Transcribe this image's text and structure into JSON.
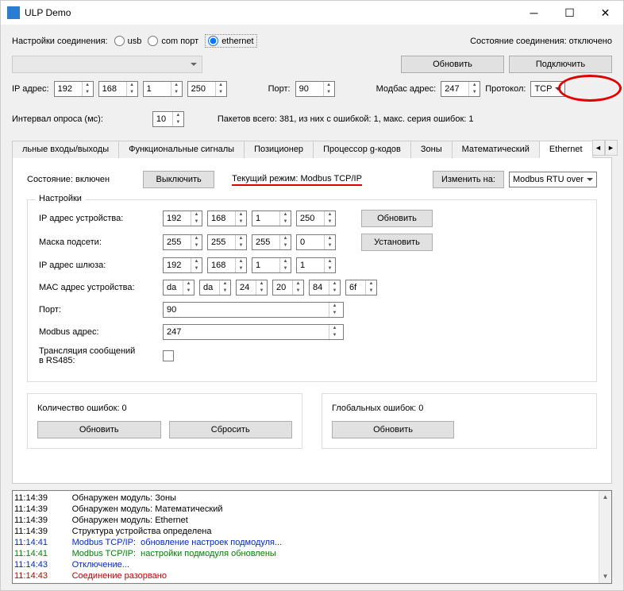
{
  "title": "ULP Demo",
  "conn": {
    "settings_label": "Настройки соединения:",
    "radio_usb": "usb",
    "radio_com": "com порт",
    "radio_eth": "ethernet",
    "status_label": "Состояние соединения: отключено",
    "refresh": "Обновить",
    "connect": "Подключить",
    "ip_label": "IP адрес:",
    "ip": [
      "192",
      "168",
      "1",
      "250"
    ],
    "port_label": "Порт:",
    "port": "90",
    "modbus_addr_label": "Модбас адрес:",
    "modbus_addr": "247",
    "protocol_label": "Протокол:",
    "protocol": "TCP",
    "interval_label": "Интервал опроса (мс):",
    "interval": "10",
    "packets": "Пакетов всего: 381, из них с ошибкой: 1, макс. серия ошибок: 1"
  },
  "tabs": {
    "t1": "льные входы/выходы",
    "t2": "Функциональные сигналы",
    "t3": "Позиционер",
    "t4": "Процессор g-кодов",
    "t5": "Зоны",
    "t6": "Математический",
    "t7": "Ethernet"
  },
  "eth": {
    "state_label": "Состояние: включен",
    "off_btn": "Выключить",
    "mode_text": "Текущий режим: Modbus TCP/IP",
    "change_to": "Изменить на:",
    "change_val": "Modbus RTU over",
    "settings_title": "Настройки",
    "ip_dev_label": "IP адрес устройства:",
    "ip_dev": [
      "192",
      "168",
      "1",
      "250"
    ],
    "refresh": "Обновить",
    "mask_label": "Маска подсети:",
    "mask": [
      "255",
      "255",
      "255",
      "0"
    ],
    "set": "Установить",
    "gw_label": "IP адрес шлюза:",
    "gw": [
      "192",
      "168",
      "1",
      "1"
    ],
    "mac_label": "MAC адрес устройства:",
    "mac": [
      "da",
      "da",
      "24",
      "20",
      "84",
      "6f"
    ],
    "port_label": "Порт:",
    "port": "90",
    "modbus_label": "Modbus адрес:",
    "modbus": "247",
    "rs485_label1": "Трансляция сообщений",
    "rs485_label2": "в RS485:",
    "err_count": "Количество ошибок: 0",
    "err_refresh": "Обновить",
    "err_reset": "Сбросить",
    "glob_err": "Глобальных ошибок: 0",
    "glob_refresh": "Обновить"
  },
  "log": [
    {
      "t": "11:14:39",
      "c": "",
      "m": "Обнаружен модуль: Зоны"
    },
    {
      "t": "11:14:39",
      "c": "",
      "m": "Обнаружен модуль: Математический"
    },
    {
      "t": "11:14:39",
      "c": "",
      "m": "Обнаружен модуль: Ethernet"
    },
    {
      "t": "11:14:39",
      "c": "",
      "m": "Структура устройства определена"
    },
    {
      "t": "11:14:41",
      "c": "t-blue",
      "m": "Modbus TCP/IP:  обновление настроек подмодуля..."
    },
    {
      "t": "11:14:41",
      "c": "t-green",
      "m": "Modbus TCP/IP:  настройки подмодуля обновлены"
    },
    {
      "t": "11:14:43",
      "c": "t-blue",
      "m": "Отключение..."
    },
    {
      "t": "11:14:43",
      "c": "t-red",
      "m": "Соединение разорвано"
    }
  ]
}
